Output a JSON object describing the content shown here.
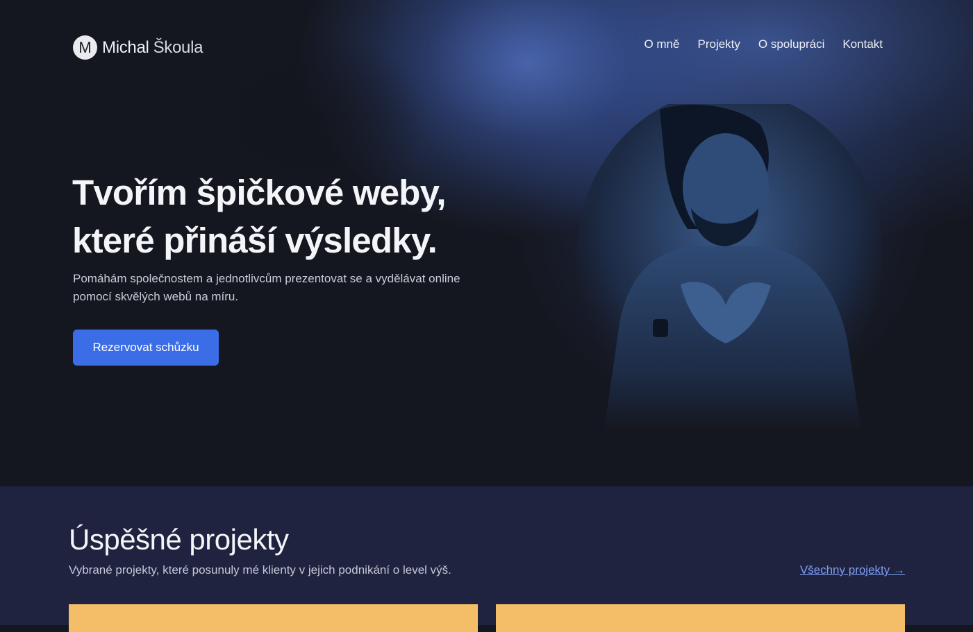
{
  "brand": {
    "logo_letter": "M",
    "first_name": "Michal",
    "last_name": "Škoula"
  },
  "nav": {
    "items": [
      {
        "label": "O mně"
      },
      {
        "label": "Projekty"
      },
      {
        "label": "O spolupráci"
      },
      {
        "label": "Kontakt"
      }
    ]
  },
  "hero": {
    "headline_line1": "Tvořím špičkové weby,",
    "headline_line2": "které přináší výsledky.",
    "subtext": "Pomáhám společnostem a jednotlivcům prezentovat se a vydělávat online pomocí skvělých webů na míru.",
    "cta_label": "Rezervovat schůzku",
    "portrait_icon": "portrait-photo"
  },
  "projects": {
    "title": "Úspěšné projekty",
    "subtitle": "Vybrané projekty, které posunuly mé klienty v jejich podnikání o level výš.",
    "all_link": "Všechny projekty →"
  },
  "colors": {
    "background": "#151720",
    "accent": "#3b6de6",
    "projects_bg": "#1f2340",
    "card": "#f4bd68",
    "link": "#7d9cf0"
  }
}
